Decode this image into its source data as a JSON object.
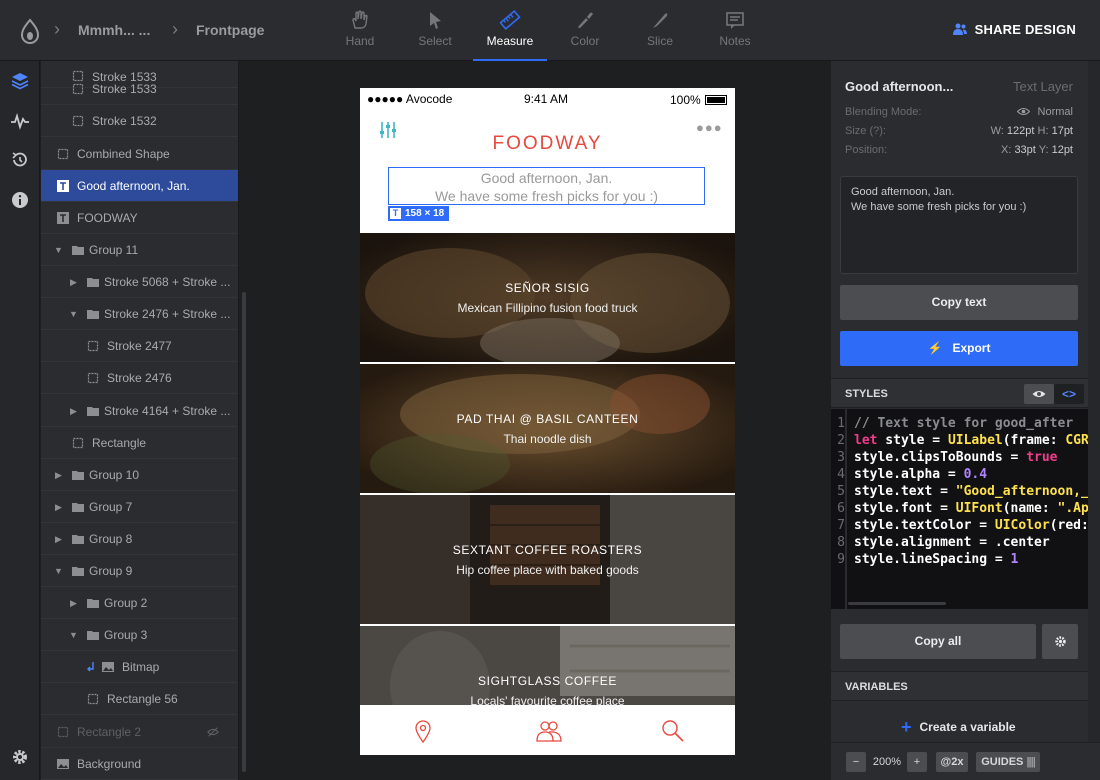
{
  "topbar": {
    "breadcrumb_project": "Mmmh... ...",
    "breadcrumb_screen": "Frontpage",
    "tools": [
      "Hand",
      "Select",
      "Measure",
      "Color",
      "Slice",
      "Notes"
    ],
    "active_tool": "Measure",
    "share_label": "SHARE DESIGN"
  },
  "layers": [
    {
      "label": "Stroke 1533",
      "kind": "rect"
    },
    {
      "label": "Stroke 1532",
      "kind": "rect"
    },
    {
      "label": "Combined Shape",
      "kind": "rect"
    },
    {
      "label": "Good afternoon, Jan.",
      "kind": "text",
      "selected": true
    },
    {
      "label": "FOODWAY",
      "kind": "text"
    },
    {
      "label": "Group 11",
      "kind": "group",
      "expanded": true
    },
    {
      "label": "Stroke 5068 + Stroke ...",
      "kind": "group"
    },
    {
      "label": "Stroke 2476 + Stroke ...",
      "kind": "group",
      "expanded": true
    },
    {
      "label": "Stroke 2477",
      "kind": "rect"
    },
    {
      "label": "Stroke 2476",
      "kind": "rect"
    },
    {
      "label": "Stroke 4164 + Stroke ...",
      "kind": "group"
    },
    {
      "label": "Rectangle",
      "kind": "rect"
    },
    {
      "label": "Group 10",
      "kind": "group"
    },
    {
      "label": "Group 7",
      "kind": "group"
    },
    {
      "label": "Group 8",
      "kind": "group"
    },
    {
      "label": "Group 9",
      "kind": "group",
      "expanded": true
    },
    {
      "label": "Group 2",
      "kind": "group"
    },
    {
      "label": "Group 3",
      "kind": "group",
      "expanded": true
    },
    {
      "label": "Bitmap",
      "kind": "image"
    },
    {
      "label": "Rectangle 56",
      "kind": "rect"
    },
    {
      "label": "Rectangle 2",
      "kind": "rect",
      "hidden": true
    },
    {
      "label": "Background",
      "kind": "image"
    }
  ],
  "phone": {
    "carrier": "●●●●● Avocode",
    "time": "9:41 AM",
    "battery": "100%",
    "brand": "FOODWAY",
    "greeting_line1": "Good afternoon, Jan.",
    "greeting_line2": "We have some fresh picks for you :)",
    "measure_label": "158 × 18",
    "cards": [
      {
        "title": "SEÑOR SISIG",
        "subtitle": "Mexican Fillipino fusion food truck",
        "color": "#5a3e24"
      },
      {
        "title": "PAD THAI @ BASIL CANTEEN",
        "subtitle": "Thai noodle dish",
        "color": "#6b4f2e"
      },
      {
        "title": "SEXTANT COFFEE ROASTERS",
        "subtitle": "Hip coffee place with baked goods",
        "color": "#3d3630"
      },
      {
        "title": "SIGHTGLASS COFFEE",
        "subtitle": "Locals' favourite coffee place",
        "color": "#5e5a55"
      }
    ]
  },
  "inspector": {
    "layer_name": "Good afternoon...",
    "layer_type": "Text Layer",
    "blending_label": "Blending Mode:",
    "blending_value": "Normal",
    "size_label": "Size (?):",
    "size_w_label": "W:",
    "size_w": "122pt",
    "size_h_label": "H:",
    "size_h": "17pt",
    "position_label": "Position:",
    "pos_x_label": "X:",
    "pos_x": "33pt",
    "pos_y_label": "Y:",
    "pos_y": "12pt",
    "text_content_line1": "Good afternoon, Jan.",
    "text_content_line2": "We have some fresh picks for you :)",
    "copy_text": "Copy text",
    "export": "Export",
    "styles_header": "STYLES",
    "code_line_numbers": [
      "1",
      "2",
      "3",
      "4",
      "5",
      "6",
      "7",
      "8",
      "9"
    ],
    "code_lines": {
      "l1": "// Text style for good_after",
      "l2_kw": "let",
      "l2_rest": " style = ",
      "l2_fn": "UILabel",
      "l2_args": "(frame: ",
      "l2_cls": "CGR",
      "l3_prop": "style.clipsToBounds = ",
      "l3_val": "true",
      "l4_prop": "style.alpha = ",
      "l4_val": "0.4",
      "l5_prop": "style.text = ",
      "l5_val": "\"Good_afternoon,_",
      "l6_prop": "style.font = ",
      "l6_fn": "UIFont",
      "l6_args": "(name: ",
      "l6_val": "\".Ap",
      "l7_prop": "style.textColor = ",
      "l7_fn": "UIColor",
      "l7_args": "(red:",
      "l8": "style.alignment = .center",
      "l9_prop": "style.lineSpacing = ",
      "l9_val": "1"
    },
    "copy_all": "Copy all",
    "variables_header": "VARIABLES",
    "create_variable": "Create a variable",
    "zoom_minus": "−",
    "zoom_value": "200%",
    "zoom_plus": "+",
    "scale": "@2x",
    "guides": "GUIDES"
  },
  "colors": {
    "accent": "#2e6bf6",
    "brand": "#e8483d",
    "panel": "#2b2c2f",
    "selected_layer": "#2d4b9a"
  }
}
